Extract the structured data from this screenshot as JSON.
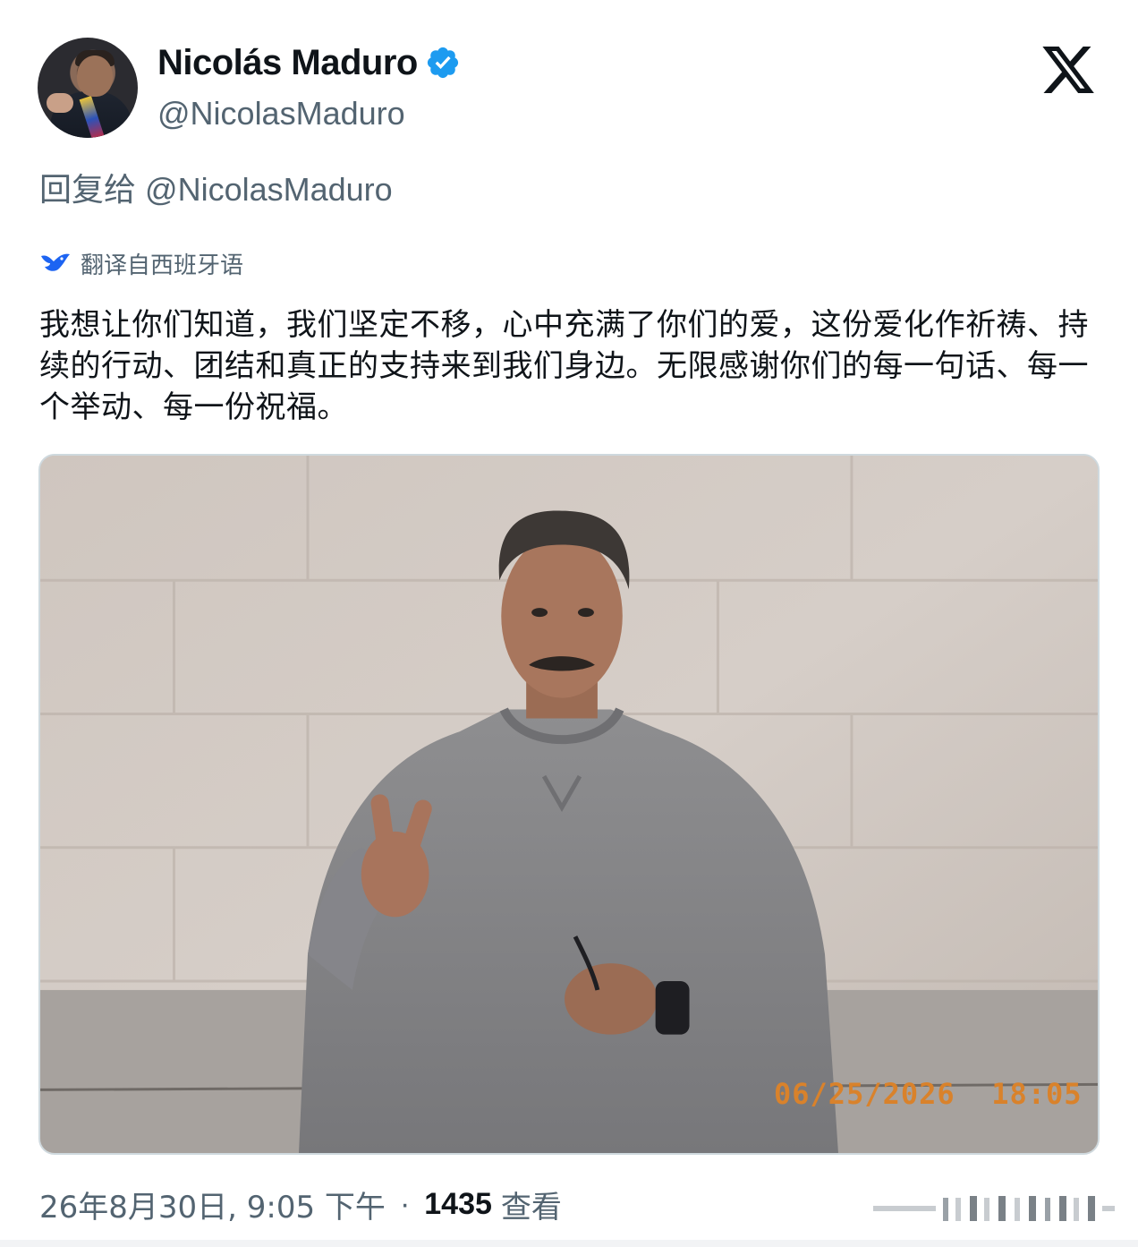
{
  "author": {
    "display_name": "Nicolás Maduro",
    "handle": "@NicolasMaduro",
    "verified": true,
    "avatar_icon": "profile-avatar"
  },
  "platform": {
    "logo_icon": "x-logo-icon"
  },
  "reply": {
    "label": "回复给",
    "handle": "@NicolasMaduro"
  },
  "translation": {
    "icon": "translate-bird-icon",
    "label": "翻译自西班牙语"
  },
  "tweet": {
    "text": "我想让你们知道，我们坚定不移，心中充满了你们的爱，这份爱化作祈祷、持续的行动、团结和真正的支持来到我们身边。无限感谢你们的每一句话、每一个举动、每一份祝福。"
  },
  "media": {
    "timestamp_overlay": "06/25/2026  18:05"
  },
  "meta": {
    "time": "26年8月30日, 9:05 下午",
    "separator": "·",
    "views_count": "1435",
    "views_label": "查看"
  },
  "colors": {
    "text_primary": "#0f1419",
    "text_secondary": "#536471",
    "verified_blue": "#1d9bf0",
    "translate_blue": "#1d64f2",
    "timestamp_orange": "#d9822b"
  }
}
